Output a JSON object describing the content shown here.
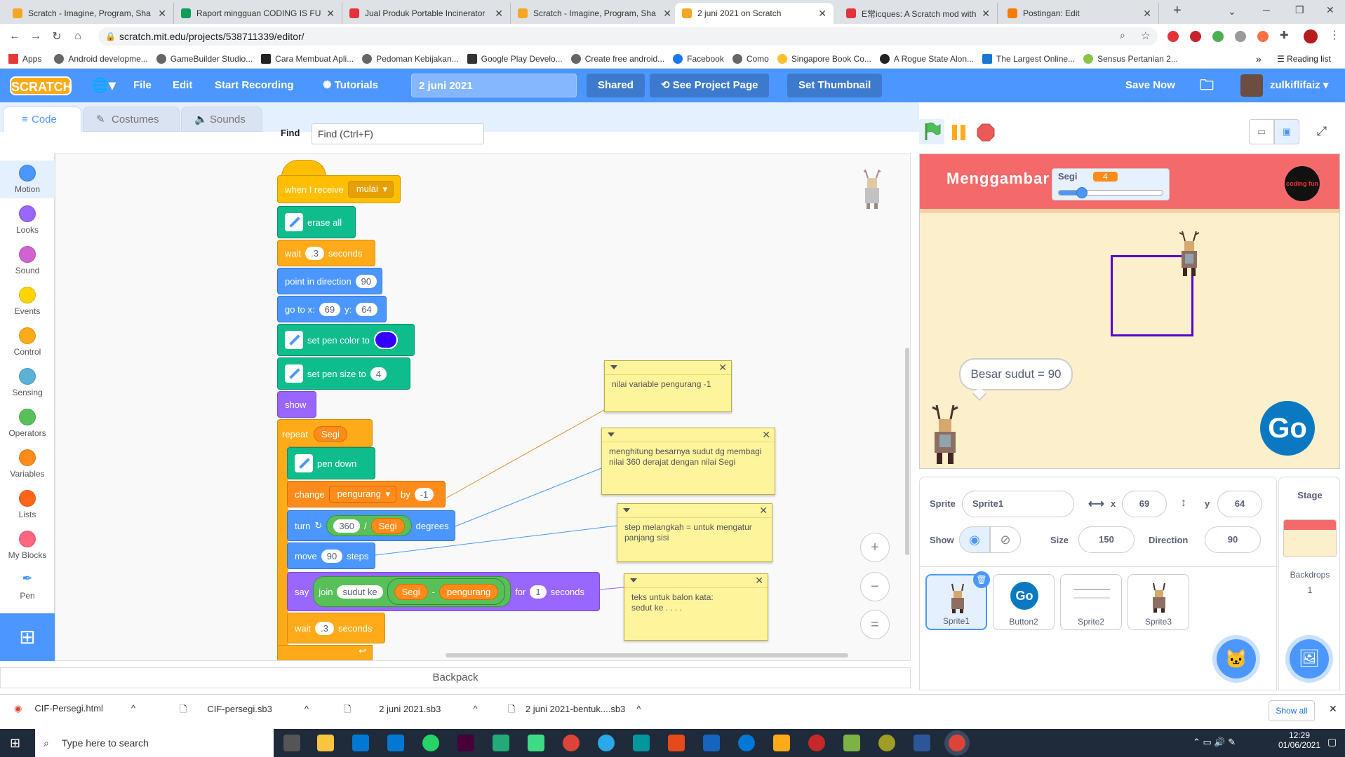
{
  "browser": {
    "tabs": [
      {
        "title": "Scratch - Imagine, Program, Sha",
        "color": "#f5a623",
        "active": false
      },
      {
        "title": "Raport mingguan CODING IS FU",
        "color": "#0f9d58",
        "active": false
      },
      {
        "title": "Jual Produk Portable Incinerator",
        "color": "#e2333b",
        "active": false
      },
      {
        "title": "Scratch - Imagine, Program, Sha",
        "color": "#f5a623",
        "active": false
      },
      {
        "title": "2 juni 2021 on Scratch",
        "color": "#f5a623",
        "active": true
      },
      {
        "title": "E常icques: A Scratch mod with a",
        "color": "#e2333b",
        "active": false
      },
      {
        "title": "Postingan: Edit",
        "color": "#f57c00",
        "active": false
      }
    ],
    "url": "scratch.mit.edu/projects/538711339/editor/",
    "bookmarks": [
      "Apps",
      "Android developme...",
      "GameBuilder Studio...",
      "Cara Membuat Apli...",
      "Pedoman Kebijakan...",
      "Google Play Develo...",
      "Create free android...",
      "Facebook",
      "Como",
      "Singapore Book Co...",
      "A Rogue State Alon...",
      "The Largest Online...",
      "Sensus Pertanian 2..."
    ],
    "reading_list": "Reading list"
  },
  "menu": {
    "logo": "SCRATCH",
    "file": "File",
    "edit": "Edit",
    "start_recording": "Start Recording",
    "tutorials": "Tutorials",
    "project_title": "2 juni 2021",
    "shared": "Shared",
    "see_project_page": "See Project Page",
    "set_thumbnail": "Set Thumbnail",
    "save_now": "Save Now",
    "username": "zulkiflifaiz"
  },
  "editor_tabs": {
    "code": "Code",
    "costumes": "Costumes",
    "sounds": "Sounds"
  },
  "find": {
    "label": "Find",
    "placeholder": "Find (Ctrl+F)"
  },
  "categories": [
    {
      "label": "Motion",
      "color": "#4c97ff"
    },
    {
      "label": "Looks",
      "color": "#9966ff"
    },
    {
      "label": "Sound",
      "color": "#cf63cf"
    },
    {
      "label": "Events",
      "color": "#ffd500"
    },
    {
      "label": "Control",
      "color": "#ffab19"
    },
    {
      "label": "Sensing",
      "color": "#5cb1d6"
    },
    {
      "label": "Operators",
      "color": "#59c059"
    },
    {
      "label": "Variables",
      "color": "#ff8c1a"
    },
    {
      "label": "Lists",
      "color": "#ff661a"
    },
    {
      "label": "My Blocks",
      "color": "#ff6680"
    },
    {
      "label": "Pen",
      "color": "#0fbd8c"
    }
  ],
  "blocks": {
    "when_receive": "when I receive",
    "message": "mulai",
    "erase_all": "erase all",
    "wait": "wait",
    "wait_val": ".3",
    "seconds": "seconds",
    "point_dir": "point in direction",
    "dir_val": "90",
    "goto": "go to x:",
    "goto_x": "69",
    "goto_y_label": "y:",
    "goto_y": "64",
    "set_pen_color": "set pen color to",
    "pen_color": "#3300ff",
    "set_pen_size": "set pen size to",
    "pen_size": "4",
    "show": "show",
    "repeat": "repeat",
    "repeat_var": "Segi",
    "pen_down": "pen down",
    "change": "change",
    "change_var": "pengurang",
    "by": "by",
    "change_val": "-1",
    "turn": "turn",
    "turn_num": "360",
    "divide": "/",
    "turn_var": "Segi",
    "degrees": "degrees",
    "move": "move",
    "move_val": "90",
    "steps": "steps",
    "say": "say",
    "join": "join",
    "join_text": "sudut ke",
    "join_var1": "Segi",
    "minus": "-",
    "join_var2": "pengurang",
    "for": "for",
    "say_secs": "1",
    "wait2_val": ".3"
  },
  "comments": [
    "nilai variable pengurang -1",
    "menghitung besarnya sudut dg membagi nilai 360 derajat dengan nilai Segi",
    "step melangkah = untuk mengatur panjang sisi",
    "teks untuk balon kata:\nsedut ke  . . . ."
  ],
  "zoom": {
    "in": "+",
    "out": "−",
    "reset": "="
  },
  "backpack": "Backpack",
  "stage": {
    "title": "Menggambar",
    "monitor_label": "Segi",
    "monitor_value": "4",
    "slider_fraction": 0.22,
    "logo_text": "coding fun",
    "speech": "Besar sudut = 90",
    "go": "Go"
  },
  "sprite_info": {
    "sprite_label": "Sprite",
    "sprite_name": "Sprite1",
    "x_label": "x",
    "x": "69",
    "y_label": "y",
    "y": "64",
    "show_label": "Show",
    "size_label": "Size",
    "size": "150",
    "direction_label": "Direction",
    "direction": "90"
  },
  "sprites": [
    "Sprite1",
    "Button2",
    "Sprite2",
    "Sprite3"
  ],
  "stage_pane": {
    "label": "Stage",
    "backdrops_label": "Backdrops",
    "backdrops_count": "1"
  },
  "downloads": {
    "files": [
      "CIF-Persegi.html",
      "CIF-persegi.sb3",
      "2 juni 2021.sb3",
      "2 juni 2021-bentuk....sb3"
    ],
    "show_all": "Show all"
  },
  "taskbar": {
    "search": "Type here to search",
    "time": "12:29",
    "date": "01/06/2021"
  }
}
